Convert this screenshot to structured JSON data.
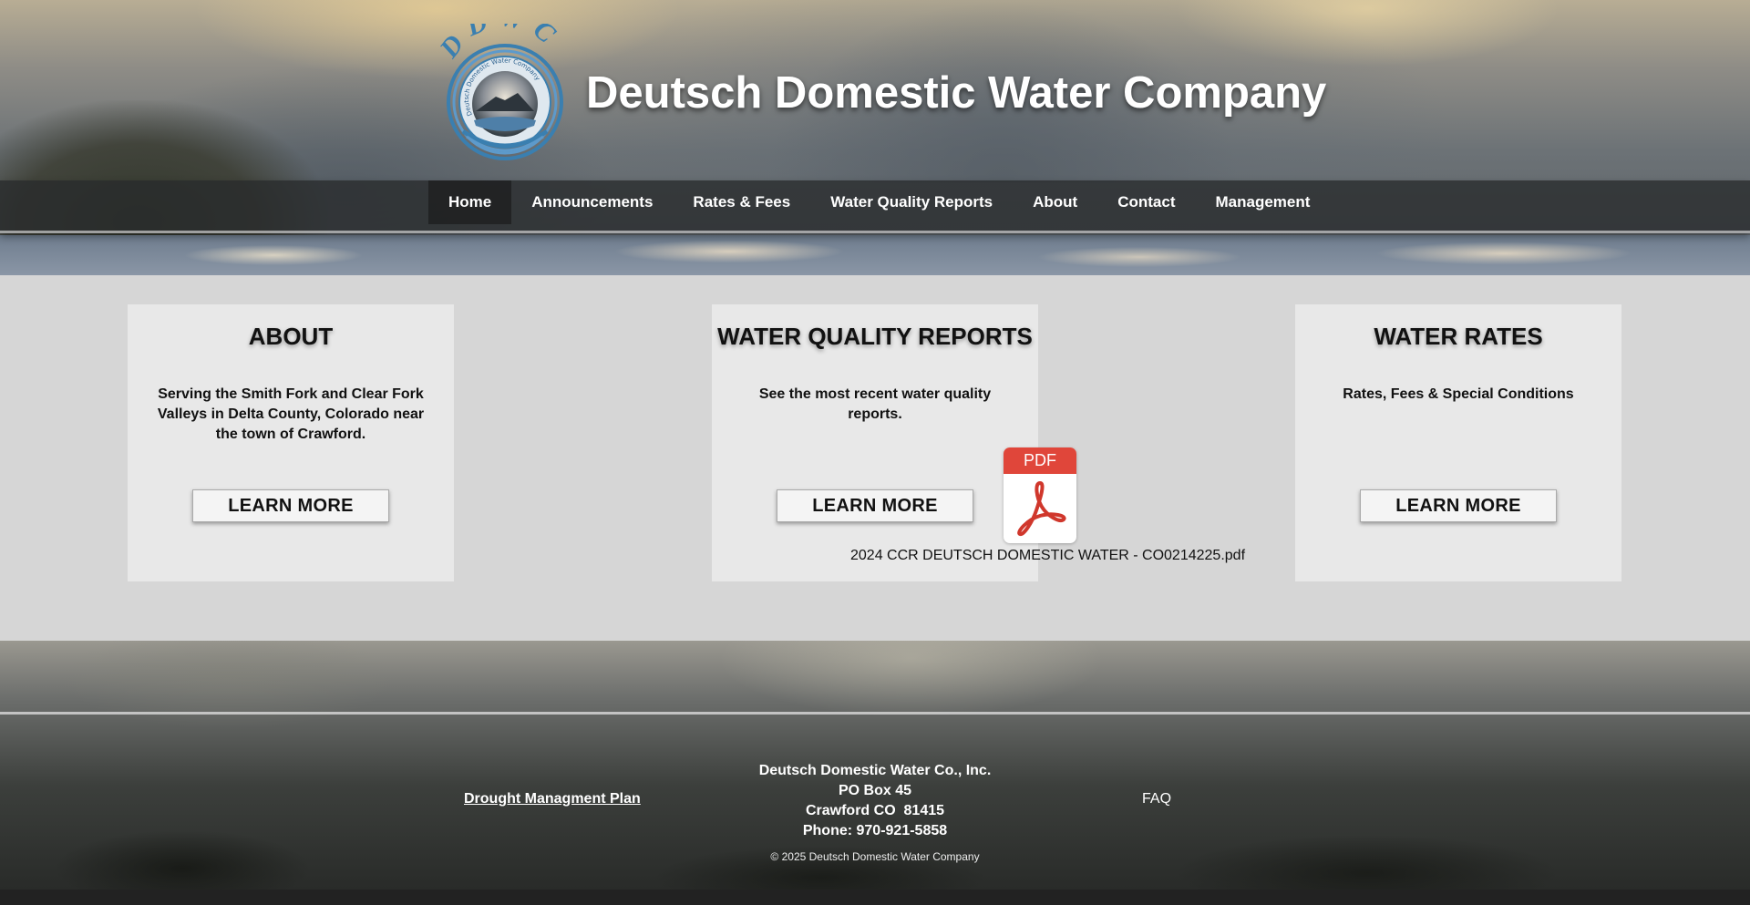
{
  "header": {
    "title": "Deutsch Domestic Water Company",
    "logo": {
      "initials": "DDWC",
      "ring_text": "Deutsch Domestic Water Company",
      "inner_ring_text": "Deutsch Domestic Water Company"
    }
  },
  "nav": {
    "items": [
      {
        "label": "Home",
        "active": true
      },
      {
        "label": "Announcements"
      },
      {
        "label": "Rates & Fees"
      },
      {
        "label": "Water Quality Reports"
      },
      {
        "label": "About"
      },
      {
        "label": "Contact"
      },
      {
        "label": "Management"
      }
    ]
  },
  "cards": {
    "about": {
      "title": "ABOUT",
      "text": "Serving the Smith Fork and Clear Fork Valleys in Delta County, Colorado near the town of Crawford.",
      "button": "LEARN MORE"
    },
    "water_quality": {
      "title": "WATER QUALITY REPORTS",
      "text": "See the most recent water quality reports.",
      "button": "LEARN MORE"
    },
    "water_rates": {
      "title": "WATER RATES",
      "text": "Rates, Fees & Special Conditions",
      "button": "LEARN MORE"
    }
  },
  "pdf": {
    "badge": "PDF",
    "icon": "pdf-file-icon",
    "filename": "2024 CCR DEUTSCH DOMESTIC WATER - CO0214225.pdf"
  },
  "footer": {
    "drought_link": "Drought Managment Plan",
    "faq_link": "FAQ",
    "address": {
      "company": "Deutsch Domestic Water Co., Inc.",
      "po_box": "PO Box 45",
      "city": "Crawford CO  81415",
      "phone": "Phone: 970-921-5858"
    },
    "copyright": "© 2025 Deutsch Domestic Water Company"
  },
  "colors": {
    "nav_bg": "#282a2c",
    "main_bg": "#d6d6d6",
    "card_bg": "#e8e8e8",
    "pdf_red": "#e0463a",
    "logo_blue": "#3a7fb0"
  }
}
